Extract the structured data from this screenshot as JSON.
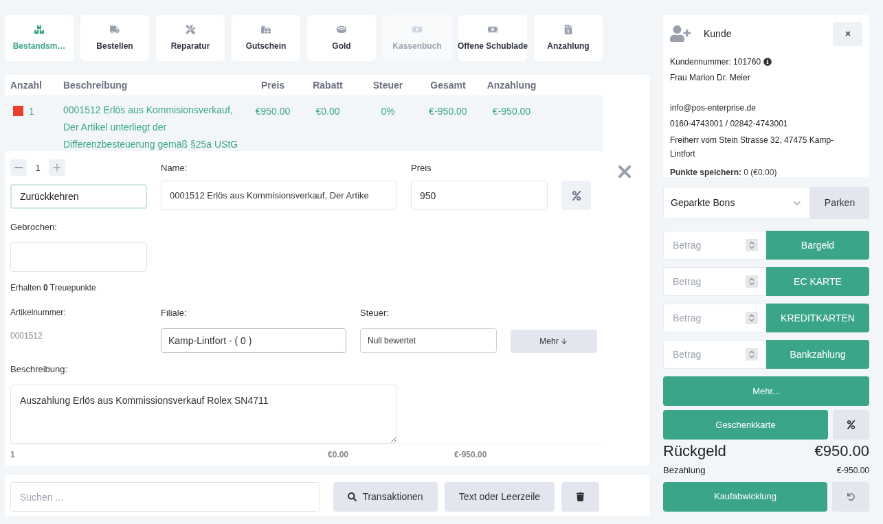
{
  "toolbar": [
    {
      "label": "Bestandsm…",
      "kind": "stock",
      "selected": true,
      "disabled": false
    },
    {
      "label": "Bestellen",
      "kind": "order",
      "selected": false,
      "disabled": false
    },
    {
      "label": "Reparatur",
      "kind": "repair",
      "selected": false,
      "disabled": false
    },
    {
      "label": "Gutschein",
      "kind": "voucher",
      "selected": false,
      "disabled": false
    },
    {
      "label": "Gold",
      "kind": "gold",
      "selected": false,
      "disabled": false
    },
    {
      "label": "Kassenbuch",
      "kind": "cashbook",
      "selected": false,
      "disabled": true
    },
    {
      "label": "Offene Schublade",
      "kind": "drawer",
      "selected": false,
      "disabled": false
    },
    {
      "label": "Anzahlung",
      "kind": "deposit",
      "selected": false,
      "disabled": false
    }
  ],
  "table": {
    "columns": [
      "Anzahl",
      "Beschreibung",
      "Preis",
      "Rabatt",
      "Steuer",
      "Gesamt",
      "Anzahlung"
    ],
    "rows": [
      {
        "color": "#e8402a",
        "qty": "1",
        "description": "0001512 Erlös aus Kommisionsverkauf, Der Artikel unterliegt der Differenzbesteuerung gemäß §25a UStG",
        "price": "€950.00",
        "discount": "€0.00",
        "tax": "0%",
        "total": "€-950.00",
        "deposit": "€-950.00"
      }
    ],
    "footer": {
      "qty": "1",
      "discount": "€0.00",
      "total": "€-950.00"
    }
  },
  "editor": {
    "qty": "1",
    "mode": "Zurückkehren",
    "name": {
      "label": "Name:",
      "value": "0001512 Erlös aus Kommisionsverkauf, Der Artike"
    },
    "price": {
      "label": "Preis",
      "value": "950"
    },
    "broken": {
      "label": "Gebrochen:"
    },
    "loyalty": "Erhalten **0** Treuepunkte",
    "article": {
      "label": "Artikelnummer:",
      "value": "0001512"
    },
    "branch": {
      "label": "Filiale:",
      "value": "Kamp-Lintfort - ( 0 )"
    },
    "tax": {
      "label": "Steuer:",
      "value": "Null bewertet"
    },
    "more": "Mehr",
    "description": {
      "label": "Beschreibung:",
      "value": "Auszahlung Erlös aus Kommissionsverkauf Rolex SN4711"
    }
  },
  "bottom": {
    "search_placeholder": "Suchen ...",
    "transactions": "Transaktionen",
    "text_line": "Text oder Leerzeile"
  },
  "customer": {
    "title": "Kunde",
    "number": "Kundennummer: 101760",
    "name": "Frau Marion Dr. Meier",
    "email": "info@pos-enterprise.de",
    "phone": "0160-4743001 / 02842-4743001",
    "address": "Freiherr vom Stein Strasse 32, 47475 Kamp-Lintfort",
    "points": "**Punkte speichern:** 0 (€0.00)"
  },
  "parked": {
    "select": "Geparkte Bons",
    "button": "Parken"
  },
  "payments": [
    {
      "placeholder": "Betrag",
      "label": "Bargeld"
    },
    {
      "placeholder": "Betrag",
      "label": "EC KARTE"
    },
    {
      "placeholder": "Betrag",
      "label": "KREDITKARTEN"
    },
    {
      "placeholder": "Betrag",
      "label": "Bankzahlung"
    }
  ],
  "more": "Mehr...",
  "gift": "Geschenkkarte",
  "change": {
    "label": "Rückgeld",
    "value": "€950.00"
  },
  "paid": {
    "label": "Bezahlung",
    "value": "€-950.00"
  },
  "checkout": "Kaufabwicklung"
}
